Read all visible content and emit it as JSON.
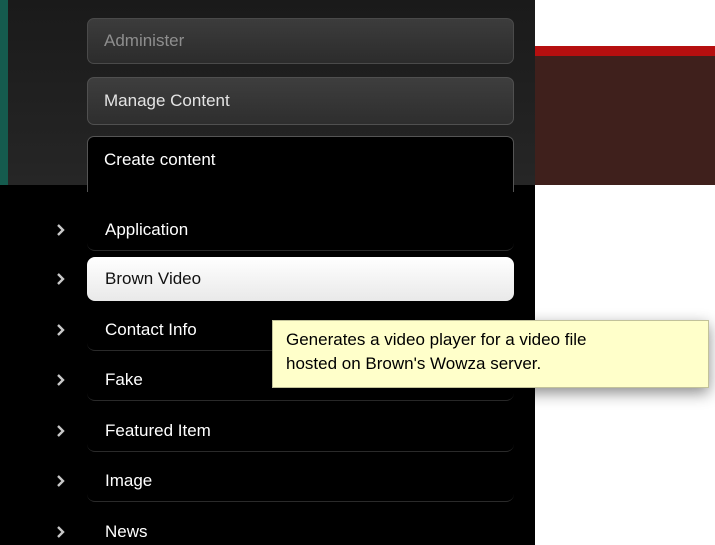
{
  "tabs": {
    "administer": "Administer",
    "manage_content": "Manage Content",
    "create_content": "Create content"
  },
  "content_types": [
    {
      "label": "Application",
      "icon": "chevron-right-icon"
    },
    {
      "label": "Brown Video",
      "icon": "chevron-right-icon",
      "selected": true
    },
    {
      "label": "Contact Info",
      "icon": "chevron-right-icon"
    },
    {
      "label": "Fake",
      "icon": "chevron-right-icon"
    },
    {
      "label": "Featured Item",
      "icon": "chevron-right-icon"
    },
    {
      "label": "Image",
      "icon": "chevron-right-icon"
    },
    {
      "label": "News",
      "icon": "chevron-right-icon"
    }
  ],
  "tooltip": {
    "line1": "Generates a video player for a video file",
    "line2": "hosted on Brown's Wowza server."
  },
  "colors": {
    "drawer_background": "#000000",
    "accent_teal": "#155b4e",
    "banner_red": "#b60f0f",
    "banner_brown": "#3f201c",
    "tooltip_background": "#ffffca"
  }
}
